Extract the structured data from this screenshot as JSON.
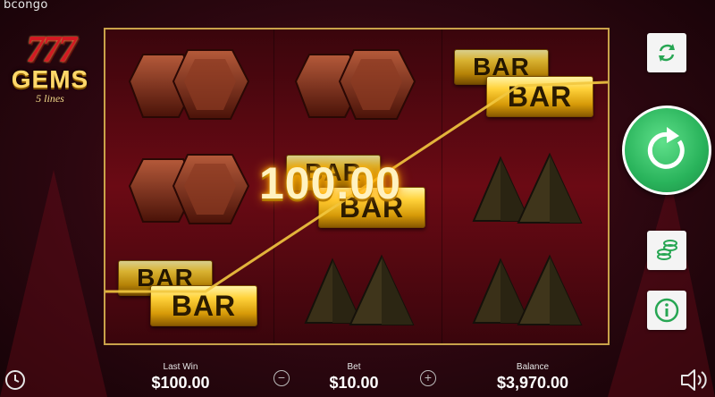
{
  "brand": "bcongo",
  "logo": {
    "top": "777",
    "middle": "GEMS",
    "bottom": "5 lines"
  },
  "win_amount": "100.00",
  "reels": [
    [
      "ruby",
      "ruby",
      "bar-double"
    ],
    [
      "ruby",
      "bar",
      "dark-gem"
    ],
    [
      "bar-double",
      "dark-gem",
      "dark-gem"
    ]
  ],
  "symbols": {
    "bar_label": "BAR"
  },
  "bottom_bar": {
    "last_win_label": "Last Win",
    "last_win_value": "$100.00",
    "bet_label": "Bet",
    "bet_value": "$10.00",
    "balance_label": "Balance",
    "balance_value": "$3,970.00",
    "minus": "−",
    "plus": "+"
  },
  "icons": {
    "autoplay": "refresh-icon",
    "spin": "spin-arrow-icon",
    "coins": "coin-stack-icon",
    "info": "info-icon",
    "history": "clock-icon",
    "sound": "speaker-icon"
  },
  "colors": {
    "spin_green": "#29b35b",
    "frame_gold": "#c9a24a",
    "background": "#2d0710"
  }
}
